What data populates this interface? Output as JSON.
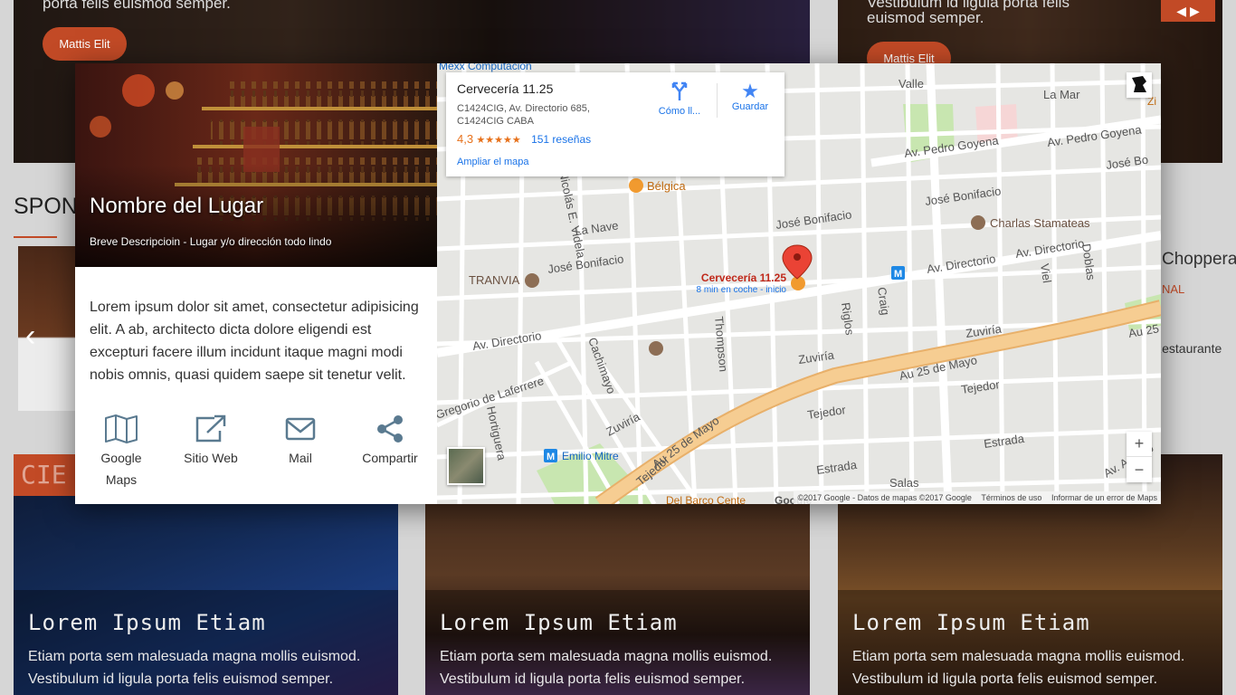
{
  "background": {
    "top_left_text": "porta felis euismod semper.",
    "top_left_button": "Mattis Elit",
    "top_right_text_1": "Vestibulum id ligula porta felis",
    "top_right_text_2": "euismod semper.",
    "top_right_button": "Mattis Elit",
    "section_heading_fragment": "SPON",
    "right_card_title_fragment": "Chopperas",
    "right_card_subtitle_fragment": "NAL",
    "right_card_text_fragment": "Restaurante",
    "category_banner_fragment": "CIE",
    "cards": [
      {
        "title": "Lorem Ipsum Etiam",
        "text_1": "Etiam porta sem malesuada magna mollis euismod.",
        "text_2": "Vestibulum id ligula porta felis euismod semper."
      },
      {
        "title": "Lorem Ipsum Etiam",
        "text_1": "Etiam porta sem malesuada magna mollis euismod.",
        "text_2": "Vestibulum id ligula porta felis euismod semper."
      },
      {
        "title": "Lorem Ipsum Etiam",
        "text_1": "Etiam porta sem malesuada magna mollis euismod.",
        "text_2": "Vestibulum id ligula porta felis euismod semper."
      }
    ]
  },
  "modal": {
    "place_name": "Nombre del Lugar",
    "place_subtitle": "Breve Descripcioin - Lugar y/o dirección todo lindo",
    "description": "Lorem ipsum dolor sit amet, consectetur adipisicing elit. A ab, architecto dicta dolore eligendi est excepturi facere illum incidunt itaque magni modi nobis omnis, quasi quidem saepe sit tenetur velit.",
    "actions": [
      {
        "label": "Google Maps",
        "icon": "map-icon"
      },
      {
        "label": "Sitio Web",
        "icon": "external-link-icon"
      },
      {
        "label": "Mail",
        "icon": "mail-icon"
      },
      {
        "label": "Compartir",
        "icon": "share-icon"
      }
    ]
  },
  "map": {
    "infocard": {
      "name": "Cervecería 11.25",
      "address": "C1424CIG, Av. Directorio 685, C1424CIG CABA",
      "rating": "4,3",
      "stars": "★★★★★",
      "reviews": "151 reseñas",
      "larger_map": "Ampliar el mapa",
      "directions": "Cómo ll...",
      "save": "Guardar"
    },
    "marker_label": "Cervecería 11.25",
    "marker_sublabel": "8 min en coche - inicio",
    "poi": {
      "belgica": "Bélgica",
      "charlas": "Charlas Stamateas",
      "tranvia": "TRANVIA",
      "emilio": "Emilio Mitre",
      "mexx": "Mexx Computacion",
      "delbarco": "Del Barco Cente",
      "zip": "Zi"
    },
    "streets": {
      "valle": "Valle",
      "lamar": "La Mar",
      "pedro_goyena_1": "Av. Pedro Goyena",
      "pedro_goyena_2": "Av. Pedro Goyena",
      "jose_bonifacio_1": "José Bonifacio",
      "jose_bonifacio_2": "José Bonifacio",
      "jose_bonifacio_3": "José Bonifacio",
      "jose_bonifacio_4": "José Bo",
      "directorio_1": "Av. Directorio",
      "directorio_2": "Av. Directorio",
      "directorio_3": "Av. Directorio",
      "la_nave": "La Nave",
      "nicolas_videla": "Nicolás E. Videla",
      "cachimayo": "Cachimayo",
      "thompson": "Thompson",
      "riglos": "Riglos",
      "craig": "Craig",
      "viel": "Viel",
      "doblas": "Doblas",
      "zuviria_1": "Zuviría",
      "zuviria_2": "Zuviría",
      "zuviria_3": "Zuviría",
      "au25_1": "Au 25 de Mayo",
      "au25_2": "Au 25 de Mayo",
      "au25_3": "Au 25",
      "tejedor_1": "Tejedor",
      "tejedor_2": "Tejedor",
      "tejedor_3": "Tejedor",
      "estrada_1": "Estrada",
      "estrada_2": "Estrada",
      "salas": "Salas",
      "av_asamblea": "Av. Asamb",
      "gregorio": "Gregorio de Laferrere",
      "hortiguera": "Hortiguera"
    },
    "footer": {
      "copyright": "©2017 Google - Datos de mapas ©2017 Google",
      "terms": "Términos de uso",
      "report": "Informar de un error de Maps"
    },
    "google_logo": "Google",
    "zoom_in": "+",
    "zoom_out": "−"
  },
  "colors": {
    "accent": "#c24a26",
    "map_link": "#1a73e8",
    "highway": "#f6c58a",
    "rating": "#e7711b"
  }
}
